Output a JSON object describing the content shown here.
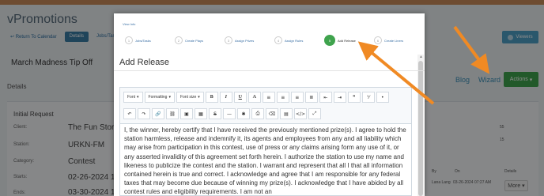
{
  "app": {
    "name": "vPromotions",
    "nav": [
      {
        "label": "Return To Calendar",
        "style": "link"
      },
      {
        "label": "Details",
        "style": "pill"
      },
      {
        "label": "Jobs/Tasks",
        "style": "link"
      }
    ],
    "viewers_label": "Viewers",
    "promotion_title": "March Madness Tip Off",
    "details_label": "Details",
    "blog_label": "Blog",
    "wizard_label": "Wizard",
    "actions_label": "Actions",
    "panel_title": "Initial Request",
    "details": [
      {
        "label": "Client:",
        "value": "The Fun Store"
      },
      {
        "label": "Station:",
        "value": "URKN-FM"
      },
      {
        "label": "Category:",
        "value": "Contest"
      },
      {
        "label": "Starts:",
        "value": "02-26-2024 12"
      },
      {
        "label": "Ends:",
        "value": "03-30-2024 11"
      }
    ],
    "right_panel": {
      "num1": "55",
      "num2": "15",
      "col_by": "By",
      "col_on": "On",
      "col_details": "Details",
      "row_by": "Lana Lang",
      "row_on": "03-26-2024 07:27 AM",
      "more_label": "More"
    }
  },
  "modal": {
    "wizard_label": "View Info",
    "title": "Add Release",
    "steps": [
      {
        "num": "1",
        "label": "Jobs/Tasks"
      },
      {
        "num": "2",
        "label": "Create Plays"
      },
      {
        "num": "3",
        "label": "Assign Prizes"
      },
      {
        "num": "4",
        "label": "Assign Rules"
      },
      {
        "num": "5",
        "label": "Add Release",
        "active": true
      },
      {
        "num": "6",
        "label": "Create Liners"
      }
    ],
    "toolbar": {
      "font": "Font",
      "formatting": "Formatting",
      "font_size": "Font size",
      "bold": "B",
      "italic": "I",
      "underline": "U",
      "font_color": "A"
    },
    "release_text": "I, the winner, hereby certify that I have received the previously mentioned prize(s). I agree to hold the station harmless, release and indemnify it, its agents and employees from any and all liability which may arise from participation in this contest, use of press or any claims arising form any use of it, or any asserted invalidity of this agreement set forth herein. I authorize the station to use my name and likeness to publicize the contest and the station. I warrant and represent that all I that all information contained herein is true and correct. I acknowledge and agree that I am responsible for any federal taxes that may become due because of winning my prize(s). I acknowledge that I have abided by all contest rules and eligibility requirements. I am not an"
  },
  "colors": {
    "accent_green": "#3fa34d",
    "link_blue": "#3a6fa5",
    "annotation_orange": "#f08a24"
  }
}
